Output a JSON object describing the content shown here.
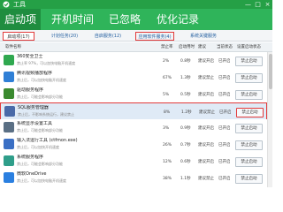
{
  "window": {
    "title": "工具",
    "controls": [
      "—",
      "□",
      "×"
    ]
  },
  "tabs": [
    {
      "label": "启动项",
      "active": true
    },
    {
      "label": "开机时间",
      "active": false
    },
    {
      "label": "已忽略",
      "active": false
    },
    {
      "label": "优化记录",
      "active": false
    }
  ],
  "subtabs": [
    {
      "label": "启动项(17)",
      "active": true
    },
    {
      "label": "计划任务(20)",
      "active": false
    },
    {
      "label": "自启服务(12)",
      "active": false
    },
    {
      "label": "应用软件服务(4)",
      "active": false,
      "highlighted": true
    },
    {
      "label": "系统关键服务",
      "active": false
    }
  ],
  "columns": [
    "软件名称",
    "禁止率",
    "启动用时",
    "建议",
    "当前状态",
    "设置启动状态"
  ],
  "rows": [
    {
      "name": "360安全卫士",
      "desc": "禁止率 97%，可以加快电脑开机速度",
      "rate": "2%",
      "time": "0.8秒",
      "advice": "建议开启",
      "status": "已开启",
      "action": "禁止启动",
      "color": "#2fa84f",
      "selected": false
    },
    {
      "name": "腾讯视频播放程序",
      "desc": "禁止后，可以加快电脑开机速度",
      "rate": "67%",
      "time": "1.3秒",
      "advice": "建议禁止",
      "status": "已开启",
      "action": "禁止启动",
      "color": "#2f7fd6",
      "selected": false
    },
    {
      "name": "驱动服务程序",
      "desc": "禁止后，可能会影响部分功能",
      "rate": "5%",
      "time": "0.5秒",
      "advice": "建议开启",
      "status": "已开启",
      "action": "禁止启动",
      "color": "#3a8a2f",
      "selected": false
    },
    {
      "name": "SQL服务管理器",
      "desc": "禁止后，不影响系统运行，建议禁止",
      "rate": "8%",
      "time": "1.2秒",
      "advice": "建议禁止",
      "status": "已开启",
      "action": "禁止启动",
      "color": "#4a6aa8",
      "selected": true
    },
    {
      "name": "系统显示设置工具",
      "desc": "禁止后，可能会影响部分功能",
      "rate": "3%",
      "time": "0.9秒",
      "advice": "建议开启",
      "status": "已开启",
      "action": "禁止启动",
      "color": "#5a6f84",
      "selected": false
    },
    {
      "name": "输入法运行工具 (ctfmon.exe)",
      "desc": "禁止后，可以加快开机速度",
      "rate": "26%",
      "time": "0.7秒",
      "advice": "建议开启",
      "status": "已开启",
      "action": "禁止启动",
      "color": "#3a6fc4",
      "selected": false
    },
    {
      "name": "系统服务程序",
      "desc": "禁止后，可能会影响部分功能",
      "rate": "12%",
      "time": "0.6秒",
      "advice": "建议开启",
      "status": "已开启",
      "action": "禁止启动",
      "color": "#2f9e8a",
      "selected": false
    },
    {
      "name": "微软OneDrive",
      "desc": "禁止后，可以加快电脑开机速度",
      "rate": "38%",
      "time": "1.1秒",
      "advice": "建议禁止",
      "status": "已开启",
      "action": "禁止启动",
      "color": "#2a7fe0",
      "selected": false
    }
  ]
}
